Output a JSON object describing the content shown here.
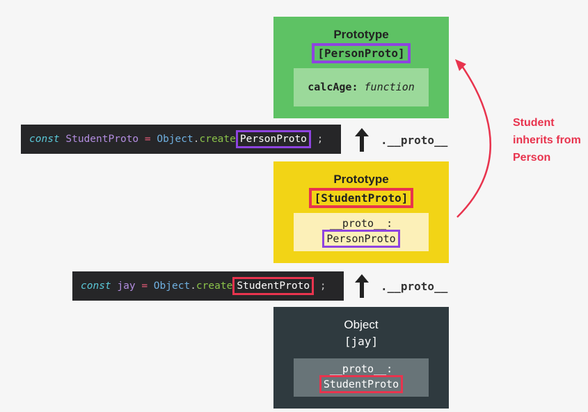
{
  "person_proto_box": {
    "title": "Prototype",
    "label": "[PersonProto]",
    "property": "calcAge:",
    "value": "function",
    "color": "#5ec264"
  },
  "student_proto_box": {
    "title": "Prototype",
    "label": "[StudentProto]",
    "property": "__proto__:",
    "value": "PersonProto",
    "color": "#f2d416"
  },
  "jay_box": {
    "title": "Object",
    "label": "[jay]",
    "property": "__proto__:",
    "value": "StudentProto",
    "color": "#2f3a3f"
  },
  "code1": {
    "keyword": "const",
    "name": "StudentProto",
    "eq": "=",
    "obj": "Object",
    "dot": ".",
    "method": "create",
    "arg": "PersonProto",
    "semi": ";"
  },
  "code2": {
    "keyword": "const",
    "name": "jay",
    "eq": "=",
    "obj": "Object",
    "dot": ".",
    "method": "create",
    "arg": "StudentProto",
    "semi": ";"
  },
  "proto_link_label": ".__proto__",
  "inheritance_note": {
    "line1": "Student",
    "line2": "inherits from",
    "line3": "Person",
    "color": "#e8344e"
  },
  "highlight_colors": {
    "purple": "#8e44e0",
    "red": "#e8344e"
  }
}
